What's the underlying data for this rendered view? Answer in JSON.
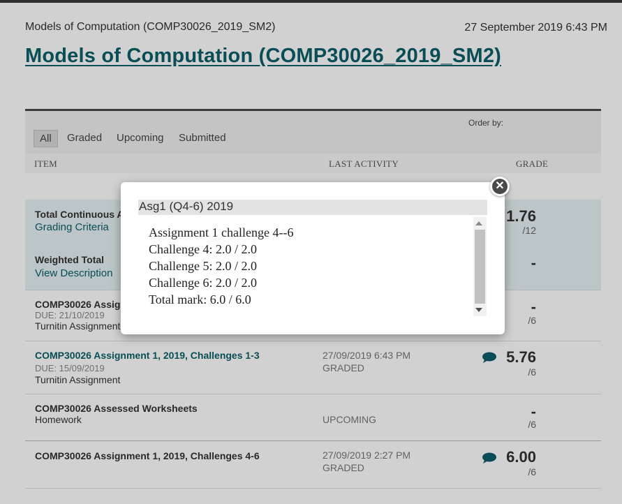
{
  "header": {
    "breadcrumb": "Models of Computation (COMP30026_2019_SM2)",
    "timestamp": "27 September 2019 6:43 PM",
    "title": "Models of Computation (COMP30026_2019_SM2)"
  },
  "filters": {
    "tabs": [
      "All",
      "Graded",
      "Upcoming",
      "Submitted"
    ],
    "active": "All",
    "order_by_label": "Order by:"
  },
  "columns": {
    "item": "ITEM",
    "last_activity": "LAST ACTIVITY",
    "grade": "GRADE"
  },
  "rows": [
    {
      "title": "Total Continuous A",
      "link": "Grading Criteria",
      "grade": "1.76",
      "out_of": "/12"
    },
    {
      "title": "Weighted Total",
      "link": "View Description",
      "grade": "-"
    },
    {
      "title": "COMP30026 Assign",
      "due": "DUE: 21/10/2019",
      "kind": "Turnitin Assignment",
      "grade": "-",
      "out_of": "/6"
    },
    {
      "title": "COMP30026 Assignment 1, 2019, Challenges 1-3",
      "due": "DUE: 15/09/2019",
      "kind": "Turnitin Assignment",
      "activity_date": "27/09/2019 6:43 PM",
      "status": "GRADED",
      "grade": "5.76",
      "out_of": "/6"
    },
    {
      "title": "COMP30026 Assessed Worksheets",
      "kind": "Homework",
      "status": "UPCOMING",
      "grade": "-",
      "out_of": "/6"
    },
    {
      "title": "COMP30026 Assignment 1, 2019, Challenges 4-6",
      "activity_date": "27/09/2019 2:27 PM",
      "status": "GRADED",
      "grade": "6.00",
      "out_of": "/6"
    }
  ],
  "modal": {
    "title": "Asg1 (Q4-6) 2019",
    "lines": [
      "Assignment 1 challenge 4--6",
      "Challenge 4: 2.0 / 2.0",
      "Challenge 5: 2.0 / 2.0",
      "Challenge 6: 2.0 / 2.0",
      "Total mark: 6.0 / 6.0"
    ],
    "close_icon": "close-icon"
  },
  "colors": {
    "accent": "#0b5f6a",
    "row_highlight": "#e6f1f5",
    "comment_icon": "#0b5f6a"
  }
}
